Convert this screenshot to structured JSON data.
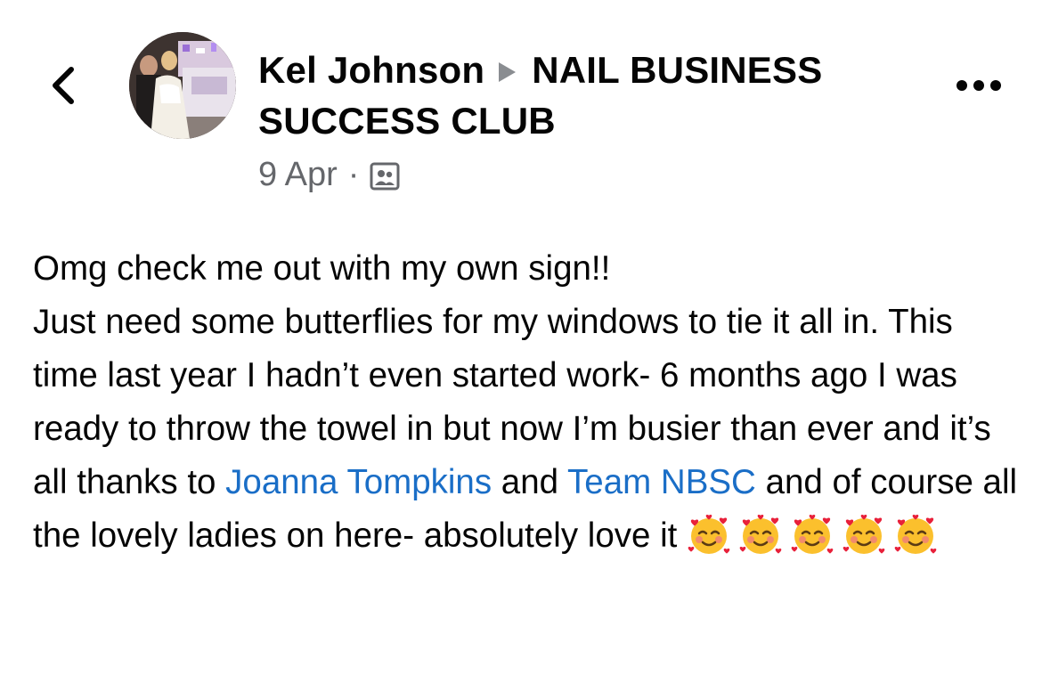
{
  "header": {
    "author_name": "Kel Johnson",
    "group_name": "NAIL BUSINESS SUCCESS CLUB",
    "date": "9 Apr",
    "separator": "·"
  },
  "icons": {
    "back": "chevron-left-icon",
    "arrow": "triangle-right-icon",
    "audience": "group-audience-icon",
    "more": "more-horizontal-icon",
    "emoji": "smiling-face-with-hearts-emoji"
  },
  "post": {
    "line1": "Omg check me out with my own sign!!",
    "text_a": "Just need some butterflies for my windows to tie it all in. This time last year I hadn’t even started work- 6 months ago I was ready to throw the towel in but now I’m busier than ever and it’s all thanks to",
    "mention1": "Joanna Tompkins",
    "text_b": "and",
    "mention2": "Team NBSC",
    "text_c": "and of course all the lovely ladies on here- absolutely love it",
    "emoji_count": 5
  },
  "colors": {
    "text": "#050505",
    "secondary": "#65676b",
    "link": "#1a6ec7"
  }
}
